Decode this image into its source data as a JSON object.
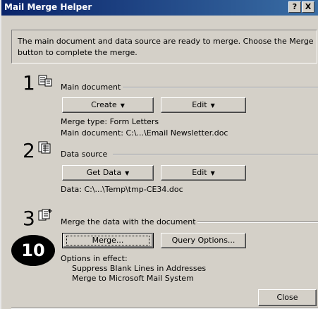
{
  "window": {
    "title": "Mail Merge Helper",
    "help_label": "?",
    "close_glyph": "X"
  },
  "intro_text": {
    "line1": "The main document and data source are ready to merge. Choose the Merge",
    "line2": "button to complete the merge."
  },
  "step1": {
    "number": "1",
    "icon": "main-document-icon",
    "label": "Main document",
    "create_label": "Create",
    "edit_label": "Edit",
    "merge_type": "Merge type: Form Letters",
    "main_doc": "Main document: C:\\...\\Email Newsletter.doc"
  },
  "step2": {
    "number": "2",
    "icon": "data-source-icon",
    "label": "Data source",
    "get_data_label": "Get Data",
    "edit_label": "Edit",
    "data_path": "Data: C:\\...\\Temp\\tmp-CE34.doc"
  },
  "step3": {
    "number": "3",
    "icon": "merge-icon",
    "label": "Merge the data with the document",
    "merge_label": "Merge...",
    "query_label": "Query Options...",
    "options_header": "Options in effect:",
    "option1": "Suppress Blank Lines in Addresses",
    "option2": "Merge to Microsoft Mail System"
  },
  "annotation": {
    "badge": "10"
  },
  "footer": {
    "close_label": "Close"
  }
}
